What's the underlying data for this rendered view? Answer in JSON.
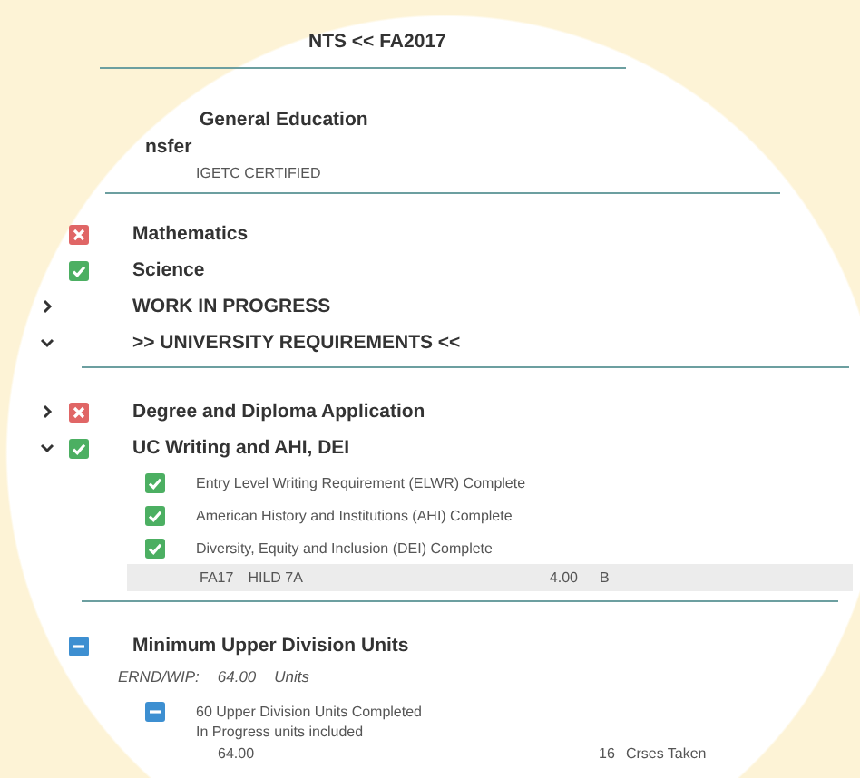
{
  "header": {
    "title": "NTS << FA2017"
  },
  "transfer_block": {
    "title": "General Education",
    "subtitle": "nsfer",
    "note": "IGETC CERTIFIED"
  },
  "requirements": [
    {
      "title": "Mathematics",
      "kind": "error"
    },
    {
      "title": "Science",
      "kind": "complete"
    },
    {
      "title": "WORK IN PROGRESS",
      "expanded": false
    },
    {
      "title": ">> UNIVERSITY REQUIREMENTS <<",
      "expanded": true
    }
  ],
  "university_requirements": [
    {
      "title": "Degree and Diploma Application",
      "kind": "error",
      "expanded": false
    },
    {
      "title": "UC Writing and AHI, DEI",
      "kind": "complete",
      "expanded": true,
      "subrequirements": [
        {
          "title": "Entry Level Writing Requirement (ELWR) Complete",
          "kind": "complete"
        },
        {
          "title": "American History and Institutions (AHI) Complete",
          "kind": "complete"
        },
        {
          "title": "Diversity, Equity and Inclusion (DEI) Complete",
          "kind": "complete"
        }
      ],
      "courses": [
        {
          "term": "FA17",
          "course": "HILD 7A",
          "units": "4.00",
          "grade": "B"
        }
      ]
    }
  ],
  "upper_division": {
    "title": "Minimum Upper Division Units",
    "kind": "partial",
    "earned_label": "ERND/WIP:",
    "earned_value": "64.00",
    "earned_unit": "Units",
    "subrequirements": [
      {
        "title": "60 Upper Division Units Completed",
        "note": "In Progress units included",
        "kind": "partial",
        "units": "64.00",
        "courses_taken": "16",
        "courses_label": "Crses Taken"
      }
    ]
  }
}
